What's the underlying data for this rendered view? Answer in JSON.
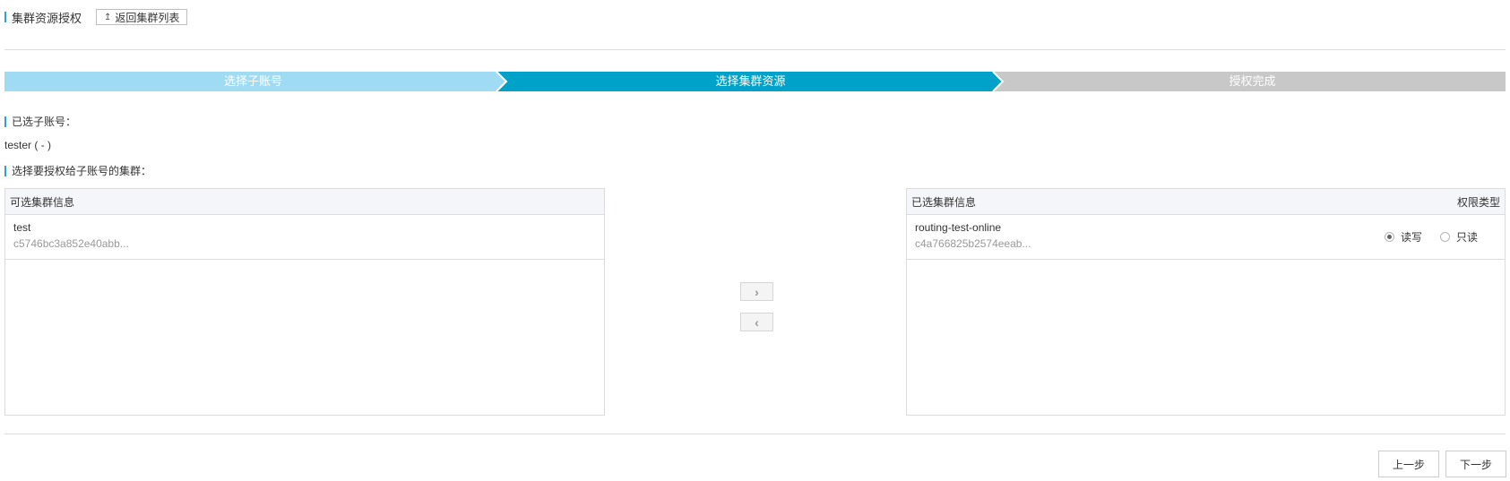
{
  "header": {
    "title": "集群资源授权",
    "back_icon": "up-arrow-icon",
    "back_label": "返回集群列表"
  },
  "steps": [
    {
      "label": "选择子账号",
      "state": "done",
      "color": "#9fdcf4"
    },
    {
      "label": "选择集群资源",
      "state": "active",
      "color": "#00a2ca"
    },
    {
      "label": "授权完成",
      "state": "pending",
      "color": "#c8c8c8"
    }
  ],
  "selected_account": {
    "label": "已选子账号：",
    "value": "tester ( - )"
  },
  "select_cluster_label": "选择要授权给子账号的集群：",
  "available": {
    "header": "可选集群信息",
    "items": [
      {
        "name": "test",
        "id": "c5746bc3a852e40abb..."
      }
    ]
  },
  "selected": {
    "header": "已选集群信息",
    "perm_header": "权限类型",
    "items": [
      {
        "name": "routing-test-online",
        "id": "c4a766825b2574eeab...",
        "permission": "读写"
      }
    ],
    "options": [
      "读写",
      "只读"
    ]
  },
  "controls": {
    "move_right_icon": "chevron-right-icon",
    "move_left_icon": "chevron-left-icon"
  },
  "footer": {
    "prev_label": "上一步",
    "next_label": "下一步"
  }
}
